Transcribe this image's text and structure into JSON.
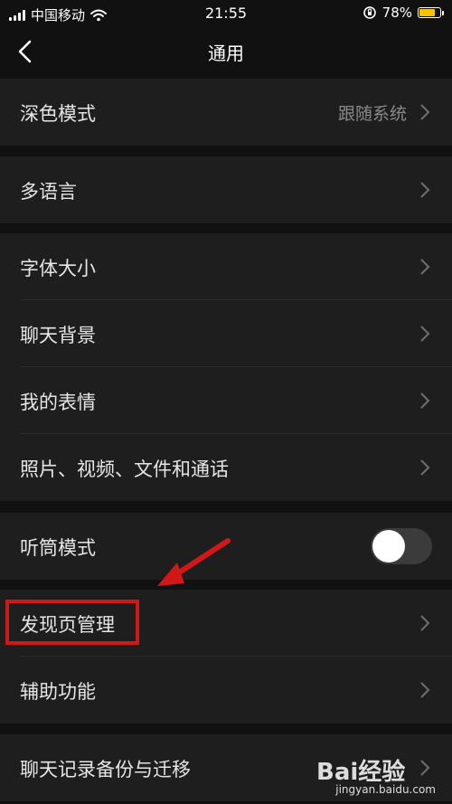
{
  "status_bar": {
    "carrier": "中国移动",
    "time": "21:55",
    "battery": "78%",
    "battery_level": 0.78
  },
  "nav": {
    "title": "通用"
  },
  "groups": [
    {
      "items": [
        {
          "label": "深色模式",
          "value": "跟随系统"
        }
      ]
    },
    {
      "items": [
        {
          "label": "多语言"
        }
      ]
    },
    {
      "items": [
        {
          "label": "字体大小"
        },
        {
          "label": "聊天背景"
        },
        {
          "label": "我的表情"
        },
        {
          "label": "照片、视频、文件和通话"
        }
      ]
    },
    {
      "items": [
        {
          "label": "听筒模式",
          "toggle": false
        }
      ]
    },
    {
      "items": [
        {
          "label": "发现页管理"
        },
        {
          "label": "辅助功能"
        }
      ]
    },
    {
      "items": [
        {
          "label": "聊天记录备份与迁移"
        }
      ]
    }
  ],
  "watermark": {
    "logo": "Bai经验",
    "url": "jingyan.baidu.com"
  },
  "colors": {
    "background": "#111111",
    "cell": "#1e1e1e",
    "highlight": "#d01818",
    "battery": "#f5c400"
  }
}
